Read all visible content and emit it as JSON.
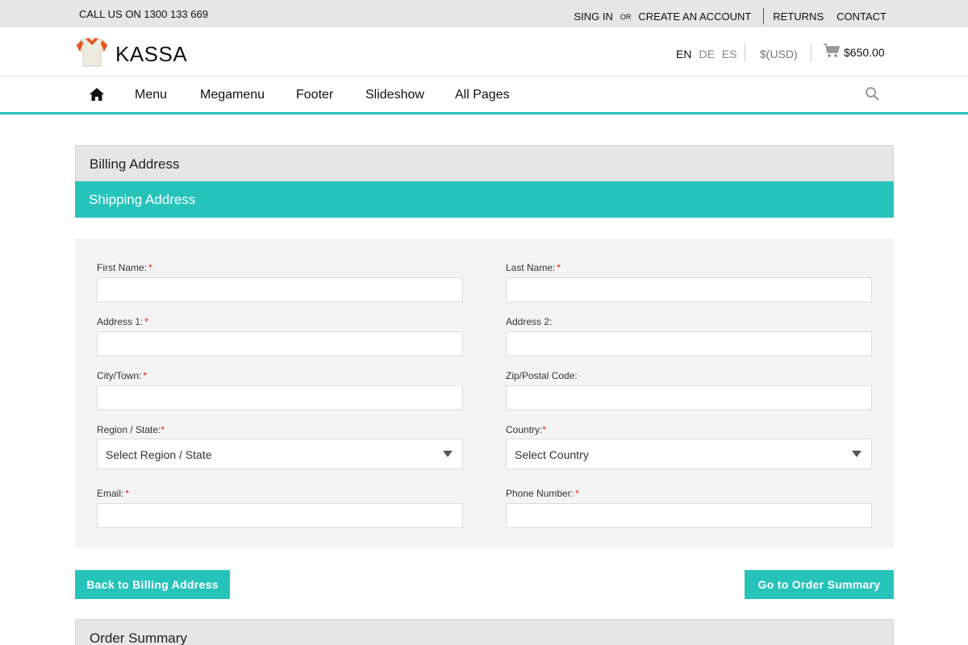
{
  "topbar": {
    "phone": "CALL US ON 1300 133 669",
    "signin": "SING IN",
    "or": "OR",
    "create_account": "CREATE AN ACCOUNT",
    "returns": "RETURNS",
    "contact": "CONTACT"
  },
  "header": {
    "logo_text": "KASSA",
    "logo_icon": "shirt-icon",
    "languages": [
      "EN",
      "DE",
      "ES"
    ],
    "active_language": "EN",
    "currency": "$(USD)",
    "cart_icon": "cart-icon",
    "cart_total": "$650.00"
  },
  "nav": {
    "home_icon": "home-icon",
    "items": [
      "Menu",
      "Megamenu",
      "Footer",
      "Slideshow",
      "All Pages"
    ],
    "search_icon": "search-icon"
  },
  "checkout": {
    "billing_title": "Billing Address",
    "shipping_title": "Shipping Address",
    "summary_title": "Order Summary",
    "fields": {
      "first_name": {
        "label": "First Name:",
        "required": "*",
        "value": ""
      },
      "last_name": {
        "label": "Last Name:",
        "required": "*",
        "value": ""
      },
      "address1": {
        "label": "Address 1:",
        "required": "*",
        "value": ""
      },
      "address2": {
        "label": "Address 2:",
        "value": ""
      },
      "city": {
        "label": "City/Town:",
        "required": "*",
        "value": ""
      },
      "zip": {
        "label": "Zip/Postal Code:",
        "value": ""
      },
      "region": {
        "label": "Region / State:",
        "required": "*",
        "selected": "Select Region / State"
      },
      "country": {
        "label": "Country:",
        "required": "*",
        "selected": "Select Country"
      },
      "email": {
        "label": "Email:",
        "required": "*",
        "value": ""
      },
      "phone": {
        "label": "Phone Number:",
        "required": "*",
        "value": ""
      }
    },
    "back_button": "Back to Billing Address",
    "next_button": "Go to Order Summary"
  },
  "colors": {
    "accent": "#26c3bb",
    "topbar_bg": "#e6e6e6",
    "form_bg": "#f4f4f4",
    "required": "#e02020"
  }
}
